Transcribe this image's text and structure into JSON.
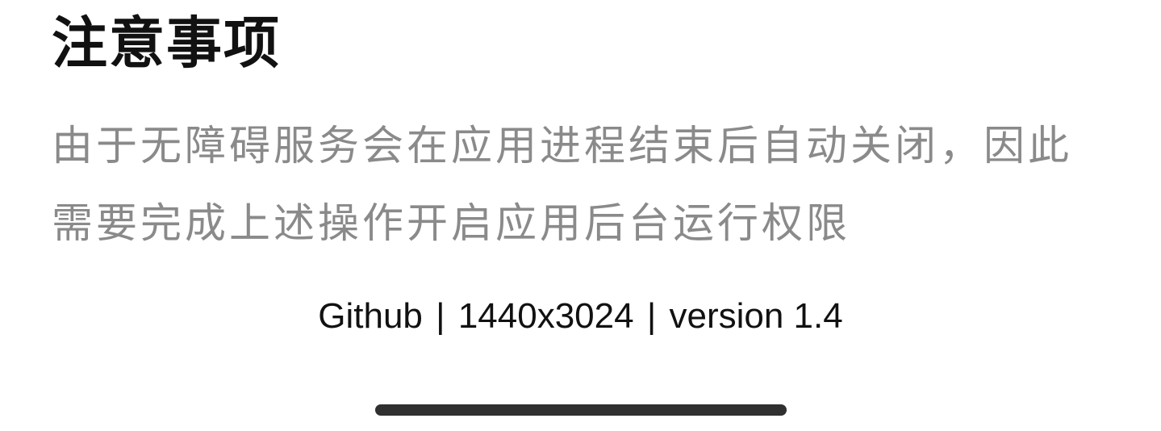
{
  "notice": {
    "title": "注意事项",
    "body_lines": [
      "由于无障碍服务会在应用进程结束后自动关闭，因此",
      "需要完成上述操作开启应用后台运行权限"
    ]
  },
  "footer": {
    "link_label": "Github",
    "separator": "|",
    "resolution": "1440x3024",
    "version": "version 1.4"
  }
}
